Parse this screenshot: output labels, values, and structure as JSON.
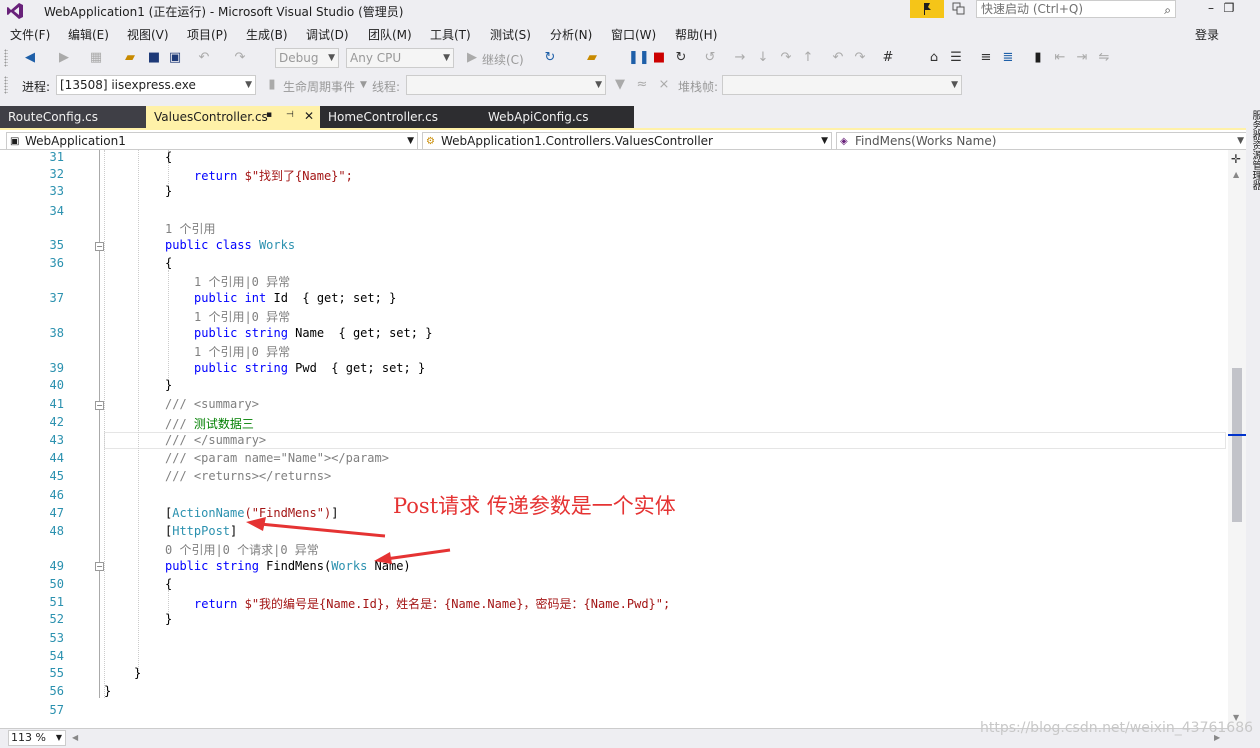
{
  "titlebar": {
    "title": "WebApplication1 (正在运行) - Microsoft Visual Studio (管理员)",
    "quick_launch_placeholder": "快速启动 (Ctrl+Q)",
    "minimize": "–",
    "restore": "❐"
  },
  "menu": {
    "items": [
      "文件(F)",
      "编辑(E)",
      "视图(V)",
      "项目(P)",
      "生成(B)",
      "调试(D)",
      "团队(M)",
      "工具(T)",
      "测试(S)",
      "分析(N)",
      "窗口(W)",
      "帮助(H)"
    ],
    "login": "登录"
  },
  "toolbar1": {
    "config": "Debug",
    "platform": "Any CPU",
    "continue": "继续(C)"
  },
  "toolbar2": {
    "process_label": "进程:",
    "process_value": "[13508] iisexpress.exe",
    "lifecycle": "生命周期事件",
    "thread_label": "线程:",
    "stackframe_label": "堆栈帧:"
  },
  "tabs": [
    {
      "label": "RouteConfig.cs"
    },
    {
      "label": "ValuesController.cs"
    },
    {
      "label": "HomeController.cs"
    },
    {
      "label": "WebApiConfig.cs"
    }
  ],
  "nav": {
    "project": "WebApplication1",
    "class": "WebApplication1.Controllers.ValuesController",
    "member": "FindMens(Works Name)"
  },
  "code": {
    "line_numbers": [
      "31",
      "32",
      "33",
      "34",
      "35",
      "36",
      "37",
      "38",
      "39",
      "40",
      "41",
      "42",
      "43",
      "44",
      "45",
      "46",
      "47",
      "48",
      "49",
      "50",
      "51",
      "52",
      "53",
      "54",
      "55",
      "56",
      "57"
    ],
    "l31": "{",
    "l32_kw": "return",
    "l32_str": "$\"找到了{Name}\";",
    "l33": "}",
    "lens35": "1 个引用",
    "l35_kw": "public class",
    "l35_ty": "Works",
    "l36": "{",
    "lens37": "1 个引用|0 异常",
    "l37_kw": "public int",
    "l37_rest": "Id  { get; set; }",
    "lens38": "1 个引用|0 异常",
    "l38_kw": "public string",
    "l38_rest": "Name  { get; set; }",
    "lens39": "1 个引用|0 异常",
    "l39_kw": "public string",
    "l39_rest": "Pwd  { get; set; }",
    "l40": "}",
    "l41": "/// <summary>",
    "l42_prefix": "///",
    "l42_text": "测试数据三",
    "l43": "/// </summary>",
    "l44": "/// <param name=\"Name\"></param>",
    "l45": "/// <returns></returns>",
    "l47_open": "[",
    "l47_attr": "ActionName",
    "l47_str": "(\"FindMens\")",
    "l47_close": "]",
    "l48_open": "[",
    "l48_attr": "HttpPost",
    "l48_close": "]",
    "lens49": "0 个引用|0 个请求|0 异常",
    "l49_kw": "public string",
    "l49_name": "FindMens(",
    "l49_ty": "Works",
    "l49_rest": " Name)",
    "l50": "{",
    "l51_kw": "return",
    "l51_str": "$\"我的编号是{Name.Id}，姓名是：{Name.Name}，密码是：{Name.Pwd}\";",
    "l52": "}",
    "l55": "}",
    "l56": "}"
  },
  "annotation": "Post请求 传递参数是一个实体",
  "zoom": "113 %",
  "watermark": "https://blog.csdn.net/weixin_43761686",
  "side_strip": "服务器资源管理器",
  "colors": {
    "active_tab": "#fff1a8",
    "keyword": "#0000ff",
    "type": "#2b91af",
    "string": "#a31515",
    "comment": "#808080",
    "annotation": "#e53333"
  }
}
